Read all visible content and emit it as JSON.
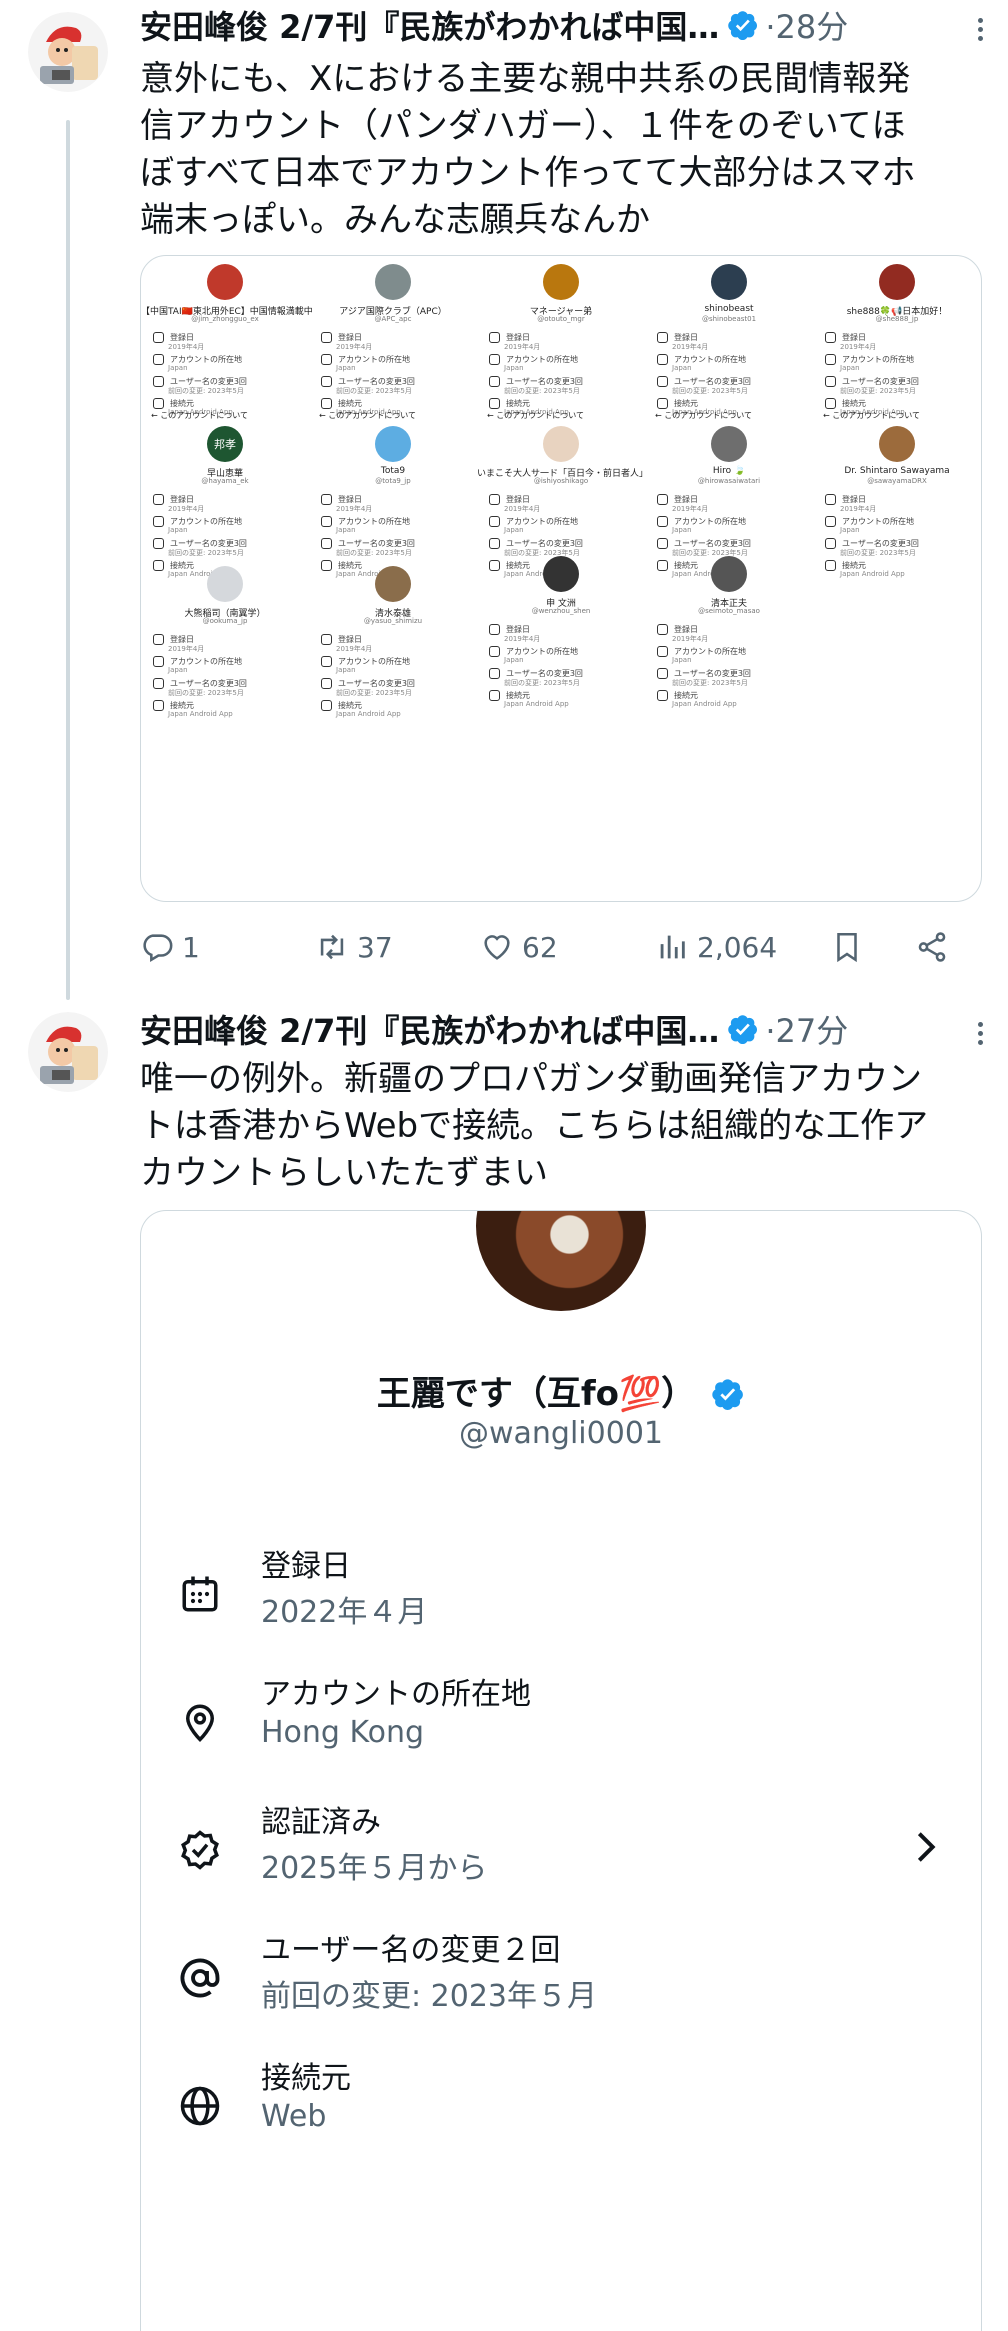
{
  "tweets": [
    {
      "author": "安田峰俊 2/7刊『民族がわかれば中国…",
      "time": "·28分",
      "lines": [
        "意外にも、Xにおける主要な親中共系の民間情報発",
        "信アカウント（パンダハガー）、１件をのぞいてほ",
        "ぼすべて日本でアカウント作ってて大部分はスマホ",
        "端末っぽい。みんな志願兵なんか"
      ],
      "stats": {
        "replies": "1",
        "retweets": "37",
        "likes": "62",
        "views": "2,064"
      }
    },
    {
      "author": "安田峰俊 2/7刊『民族がわかれば中国…",
      "time": "·27分",
      "lines": [
        "唯一の例外。新疆のプロパガンダ動画発信アカウン",
        "トは香港からWebで接続。こちらは組織的な工作ア",
        "カウントらしいたたずまい"
      ]
    }
  ],
  "collage": {
    "profiles": [
      {
        "name": "【中国TAI🇨🇳東北用外EC】中国情報満載中",
        "handle": "@jim_zhongguo_ex"
      },
      {
        "name": "アジア国際クラブ（APC）",
        "handle": "@APC_apc"
      },
      {
        "name": "マネージャー弟",
        "handle": "@otouto_mgr"
      },
      {
        "name": "shinobeast",
        "handle": "@shinobeast01"
      },
      {
        "name": "she888🍀📢日本加好！",
        "handle": "@she888_jp"
      },
      {
        "name": "早山恵華",
        "handle": "@hayama_ek"
      },
      {
        "name": "Tota9",
        "handle": "@tota9_jp"
      },
      {
        "name": "いまこそ大人サ一ド「百日今・前日者人」",
        "handle": "@ishiyoshikago"
      },
      {
        "name": "Hiro 🍃",
        "handle": "@hirowasaiwatari"
      },
      {
        "name": "Dr. Shintaro Sawayama",
        "handle": "@sawayamaDRX"
      },
      {
        "name": "大熊稲司（南翼学）",
        "handle": "@ookuma_jp"
      },
      {
        "name": "清水泰雄",
        "handle": "@yasuo_shimizu"
      },
      {
        "name": "申 文洲",
        "handle": "@wenzhou_shen"
      },
      {
        "name": "清本正夫",
        "handle": "@seimoto_masao"
      }
    ],
    "row_labels": [
      "登録日",
      "アカウントの所在地",
      "ユーザー名の変更3回",
      "接続元"
    ],
    "row_subs": [
      "2019年4月",
      "Japan",
      "前回の変更: 2023年5月",
      "Japan Android App"
    ],
    "nav_title": "このアカウントについて",
    "emblem_text": "邦孝"
  },
  "profile_card": {
    "name": "王麗です（互fo💯）",
    "handle": "@wangli0001",
    "rows": [
      {
        "title": "登録日",
        "sub": "2022年４月",
        "icon": "calendar-icon"
      },
      {
        "title": "アカウントの所在地",
        "sub": "Hong Kong",
        "icon": "location-pin-icon"
      },
      {
        "title": "認証済み",
        "sub": "2025年５月から",
        "icon": "verified-badge-icon"
      },
      {
        "title": "ユーザー名の変更２回",
        "sub": "前回の変更: 2023年５月",
        "icon": "at-sign-icon"
      },
      {
        "title": "接続元",
        "sub": "Web",
        "icon": "globe-icon"
      }
    ]
  },
  "colors": {
    "verified": "#1d9bf0",
    "muted": "#536471",
    "border": "#cfd9de"
  }
}
